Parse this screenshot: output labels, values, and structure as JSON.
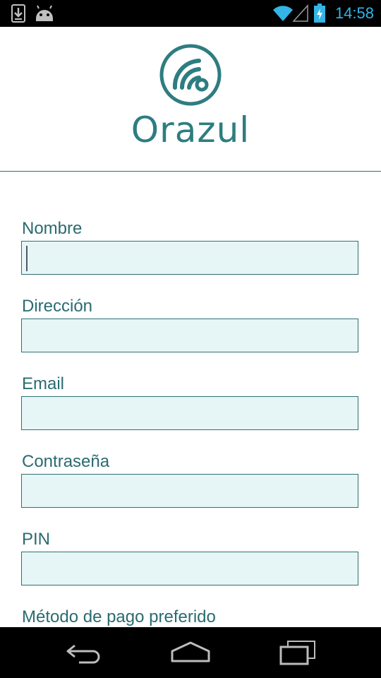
{
  "status_bar": {
    "time": "14:58",
    "left_icons": [
      "download-icon",
      "android-icon"
    ],
    "right_icons": [
      "wifi-icon",
      "signal-icon",
      "battery-charging-icon"
    ],
    "accent_color": "#33b5e5"
  },
  "header": {
    "logo_icon": "orazul-logo-icon",
    "app_name": "Orazul",
    "brand_color": "#2e7d80"
  },
  "form": {
    "fields": [
      {
        "label": "Nombre",
        "value": "",
        "focused": true
      },
      {
        "label": "Dirección",
        "value": ""
      },
      {
        "label": "Email",
        "value": ""
      },
      {
        "label": "Contraseña",
        "value": ""
      },
      {
        "label": "PIN",
        "value": ""
      }
    ],
    "payment_label": "Método de pago preferido"
  },
  "nav_bar": {
    "buttons": [
      "back-icon",
      "home-icon",
      "recent-apps-icon"
    ]
  }
}
